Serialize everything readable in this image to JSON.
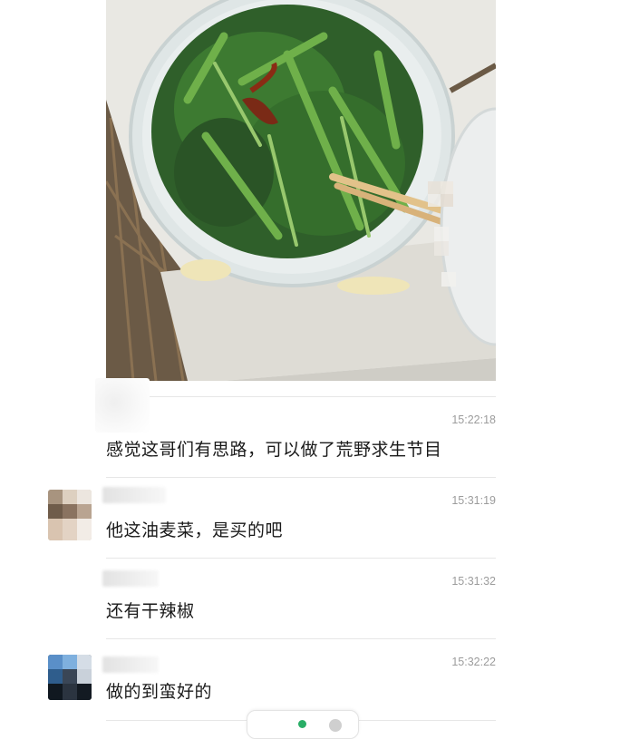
{
  "photo": {
    "description_icon": "food-photo-icon"
  },
  "messages": [
    {
      "time": "15:22:18",
      "text": "感觉这哥们有思路，可以做了荒野求生节目"
    },
    {
      "time": "15:31:19",
      "text": "他这油麦菜，是买的吧"
    },
    {
      "time": "15:31:32",
      "text": "还有干辣椒"
    },
    {
      "time": "15:32:22",
      "text": "做的到蛮好的"
    }
  ],
  "colors": {
    "text": "#1a1a1a",
    "timestamp": "#9c9c9c",
    "divider": "#e6e6e6",
    "status_green": "#2aae67"
  }
}
